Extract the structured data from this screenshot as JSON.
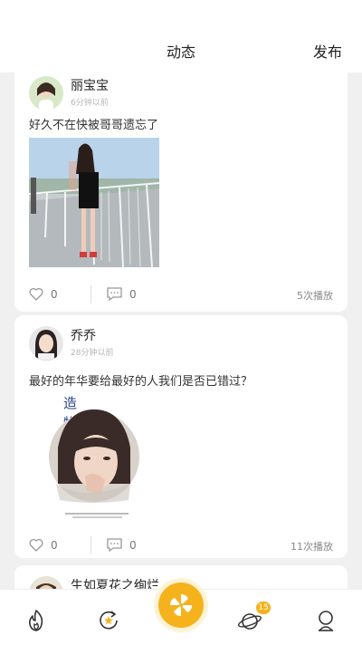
{
  "header": {
    "title": "动态",
    "publish_label": "发布"
  },
  "posts": [
    {
      "author": "丽宝宝",
      "time": "6分钟以前",
      "text": "好久不在快被哥哥遗忘了",
      "likes": "0",
      "comments": "0",
      "plays": "5次播放"
    },
    {
      "author": "乔乔",
      "time": "28分钟以前",
      "text": "最好的年华要给最好的人我们是否已错过？",
      "likes": "0",
      "comments": "0",
      "plays": "11次播放",
      "image_text": "造物"
    },
    {
      "author": "生如夏花之绚烂"
    }
  ],
  "tabbar": {
    "items": [
      {
        "icon": "flame-icon"
      },
      {
        "icon": "refresh-star-icon"
      },
      {
        "icon": "pinwheel-icon"
      },
      {
        "icon": "planet-icon",
        "badge": "15"
      },
      {
        "icon": "profile-icon"
      }
    ]
  },
  "colors": {
    "accent": "#f5b21c",
    "background": "#f0f0f0"
  }
}
